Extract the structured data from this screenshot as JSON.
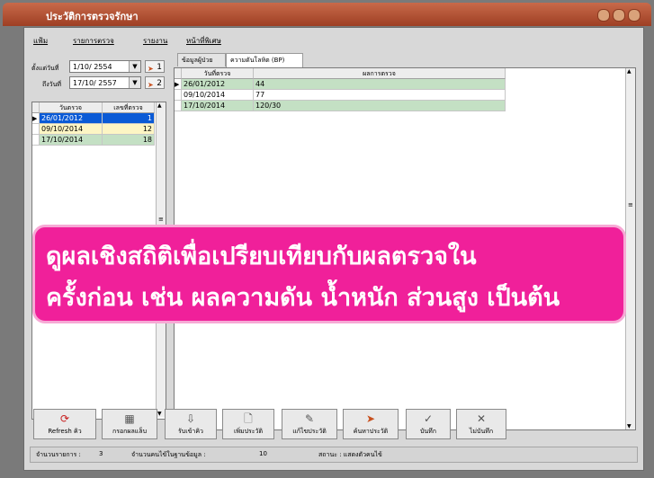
{
  "window": {
    "title": "ประวัติการตรวจรักษา"
  },
  "menu": [
    "แฟ้ม",
    "รายการตรวจ",
    "รายงาน",
    "หน้าที่พิเศษ"
  ],
  "filter": {
    "from_label": "ตั้งแต่วันที่",
    "from_value": "1/10/ 2554",
    "from_btn": "1",
    "to_label": "ถึงวันที่",
    "to_value": "17/10/ 2557",
    "to_btn": "2"
  },
  "left_grid": {
    "headers": [
      "วันตรวจ",
      "เลขที่ตรวจ"
    ],
    "rows": [
      {
        "date": "26/01/2012",
        "num": "1"
      },
      {
        "date": "09/10/2014",
        "num": "12"
      },
      {
        "date": "17/10/2014",
        "num": "18"
      }
    ]
  },
  "tabs": [
    "ข้อมูลผู้ป่วย",
    "ความดันโลหิต (BP)"
  ],
  "right_grid": {
    "headers": [
      "วันที่ตรวจ",
      "ผลการตรวจ"
    ],
    "rows": [
      {
        "date": "26/01/2012",
        "result": "44"
      },
      {
        "date": "09/10/2014",
        "result": "77"
      },
      {
        "date": "17/10/2014",
        "result": "120/30"
      }
    ]
  },
  "toolbar": [
    {
      "icon": "refresh-icon",
      "label": "Refresh คิว"
    },
    {
      "icon": "fill-results-icon",
      "label": "กรอกผลแล็บ"
    },
    {
      "icon": "receive-queue-icon",
      "label": "รับเข้าคิว"
    },
    {
      "icon": "add-history-icon",
      "label": "เพิ่มประวัติ"
    },
    {
      "icon": "edit-history-icon",
      "label": "แก้ไขประวัติ"
    },
    {
      "icon": "search-history-icon",
      "label": "ค้นหาประวัติ"
    },
    {
      "icon": "save-icon",
      "label": "บันทึก"
    },
    {
      "icon": "cancel-icon",
      "label": "ไม่บันทึก"
    }
  ],
  "status": {
    "count_label": "จำนวนรายการ :",
    "count_value": "3",
    "db_label": "จำนวนคนไข้ในฐานข้อมูล :",
    "db_value": "10",
    "state_label": "สถานะ : แสดงตัวคนไข้"
  },
  "callout": {
    "line1": "ดูผลเชิงสถิติเพื่อเปรียบเทียบกับผลตรวจใน",
    "line2": "ครั้งก่อน เช่น ผลความดัน น้ำหนัก ส่วนสูง เป็นต้น"
  },
  "colors": {
    "selected_row": "#0a5ad6",
    "green_row": "#c4e0c4",
    "callout": "#f0209a"
  }
}
